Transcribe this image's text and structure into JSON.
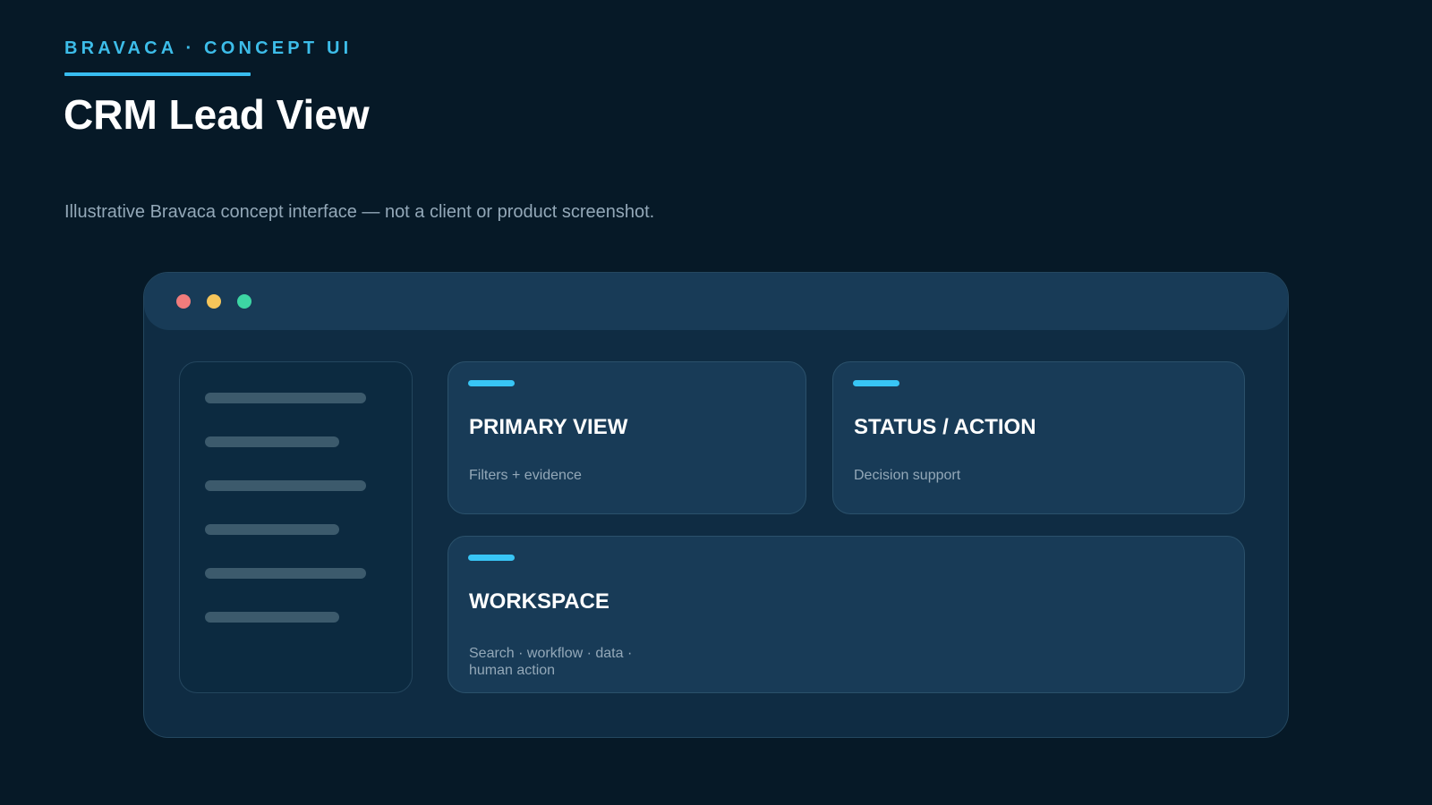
{
  "header": {
    "eyebrow": "BRAVACA · CONCEPT UI",
    "title": "CRM Lead View",
    "disclaimer": "Illustrative Bravaca concept interface — not a client or product screenshot."
  },
  "window": {
    "controls": [
      "close",
      "minimize",
      "maximize"
    ],
    "sidebar": {
      "items": 6
    },
    "cards": {
      "primary": {
        "title": "PRIMARY VIEW",
        "subtitle": "Filters + evidence"
      },
      "status": {
        "title": "STATUS / ACTION",
        "subtitle": "Decision support"
      },
      "workspace": {
        "title": "WORKSPACE",
        "subtitle_line1": "Search · workflow · data ·",
        "subtitle_line2": "human action"
      }
    }
  },
  "colors": {
    "background": "#061927",
    "accent": "#38bdf0",
    "window": "#0f2c43",
    "card": "#183b57",
    "dot_red": "#f07c7c",
    "dot_yellow": "#f5c55a",
    "dot_green": "#3dd6a4"
  }
}
